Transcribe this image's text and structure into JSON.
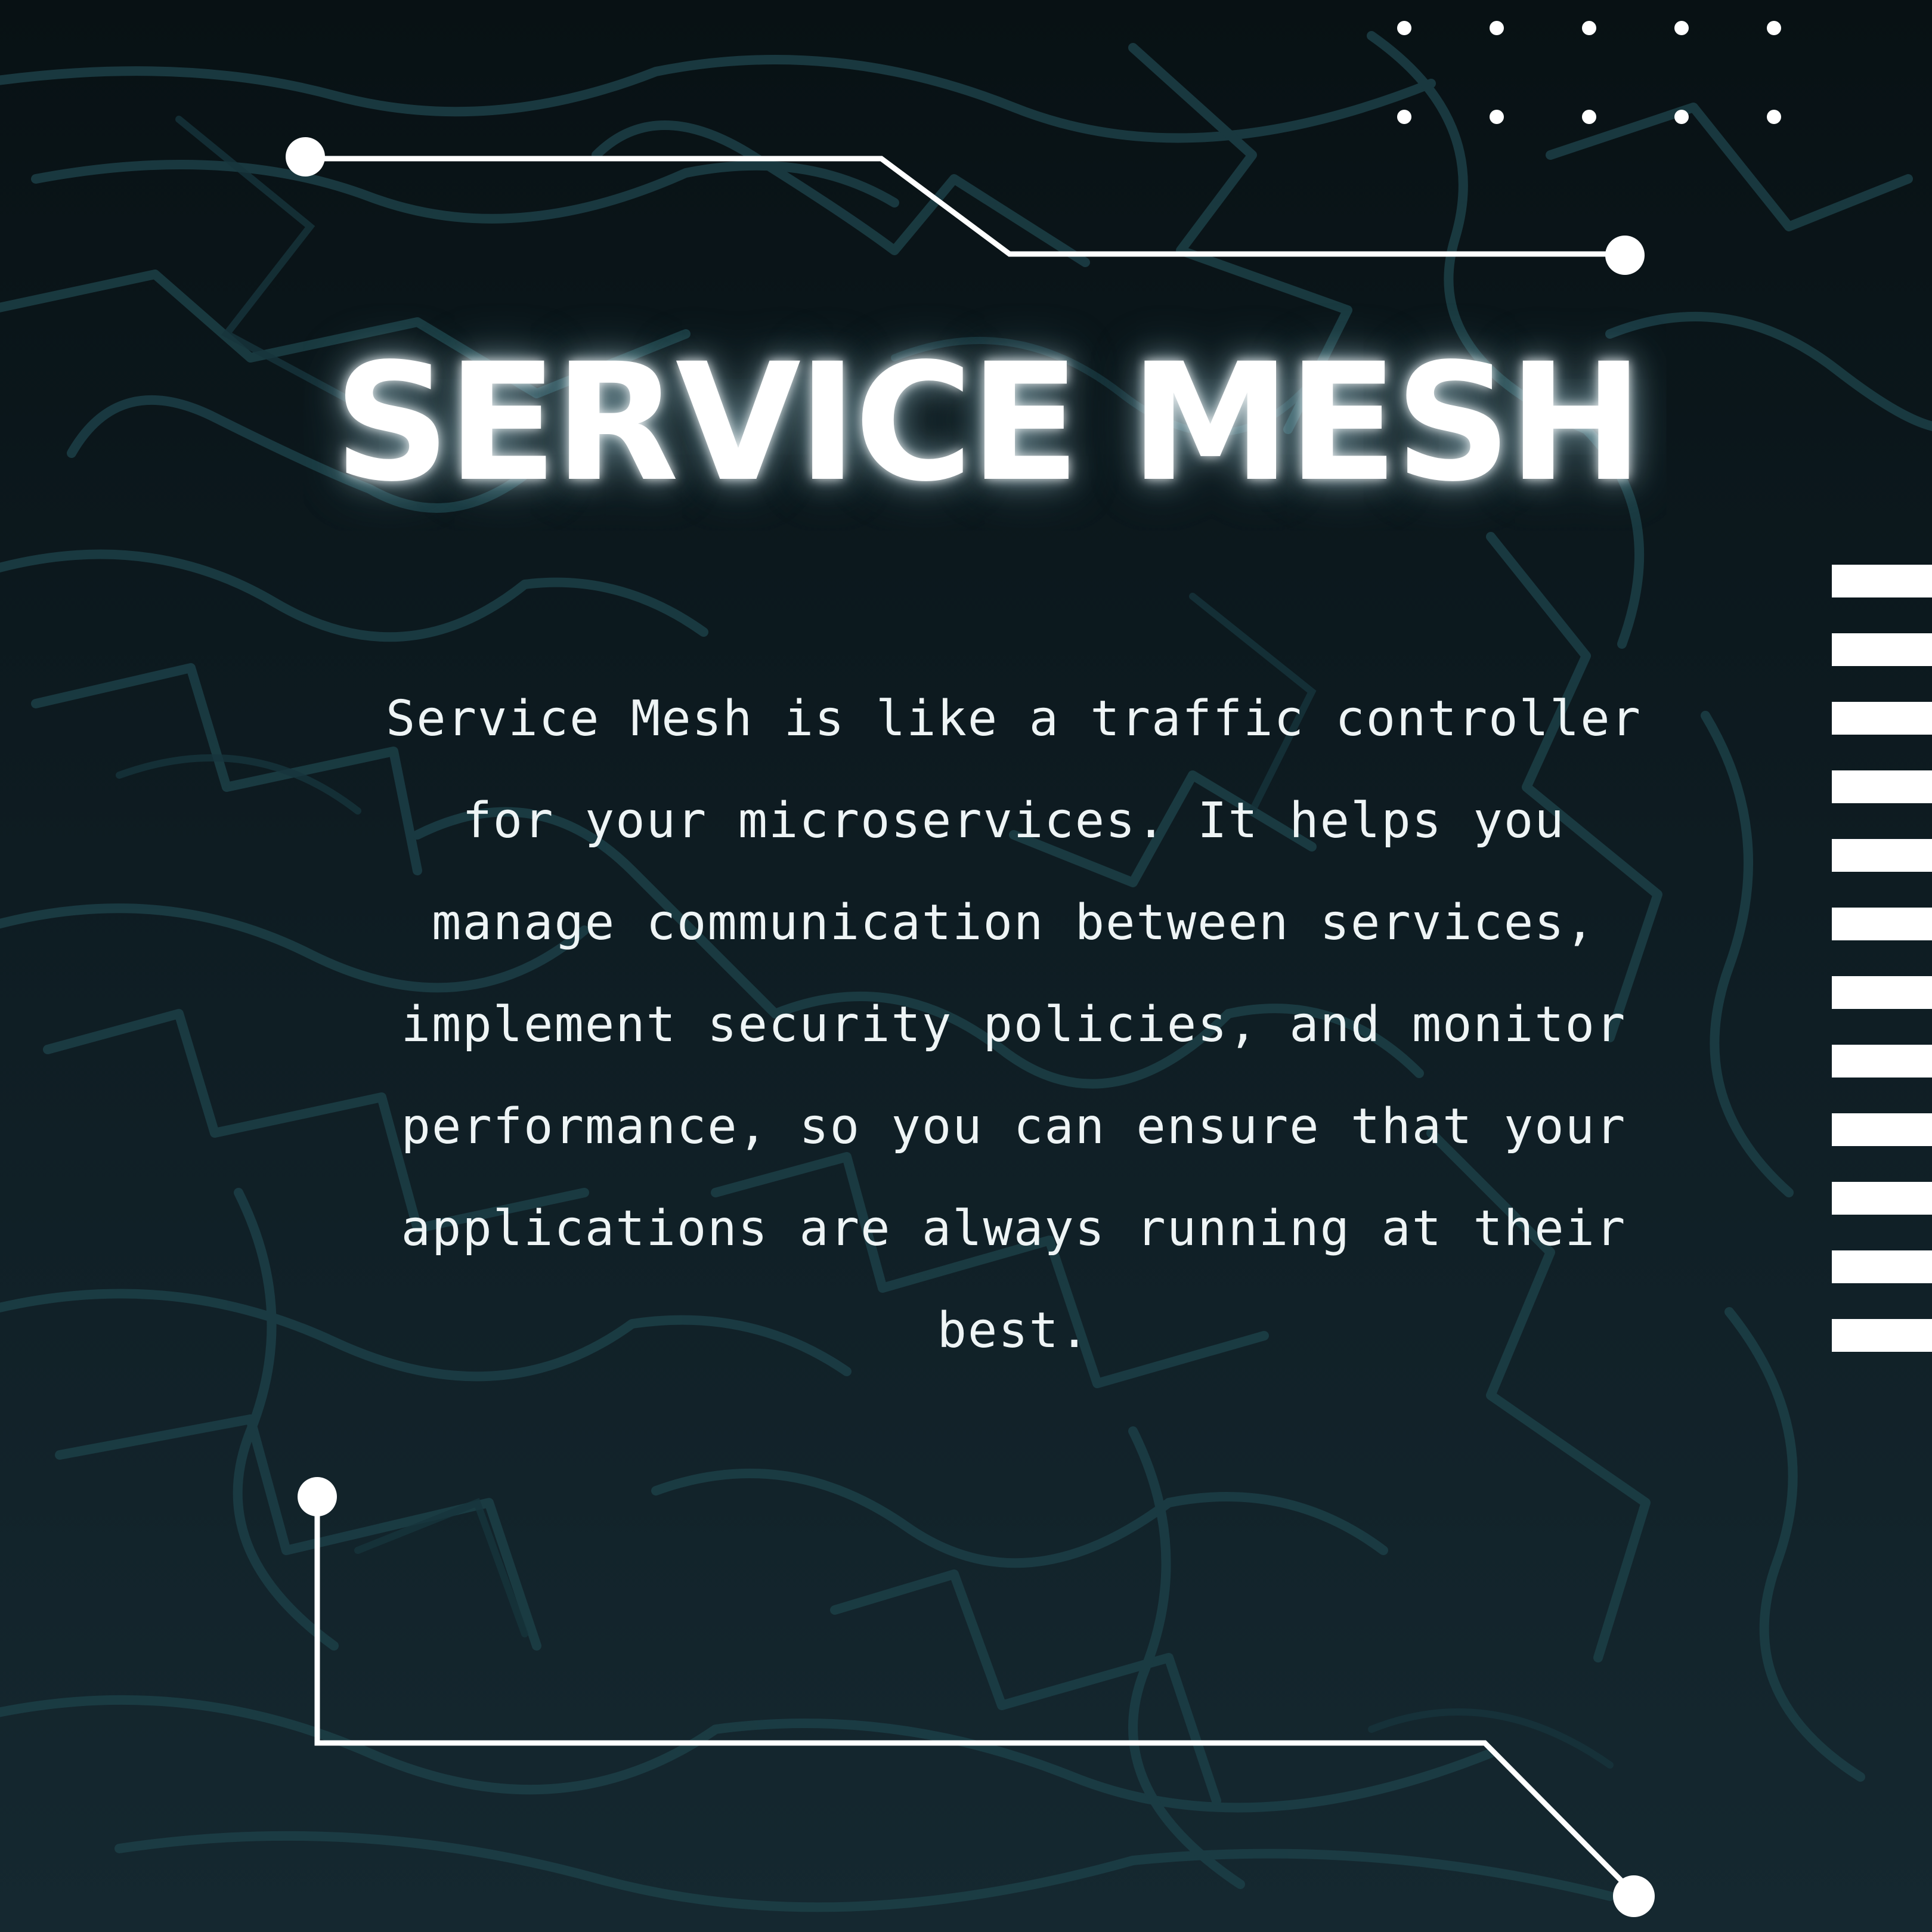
{
  "title": "SERVICE MESH",
  "description": "Service Mesh is like a traffic controller for your microservices. It helps you manage communication between services, implement security policies, and monitor performance, so you can ensure that your applications are always running at their best.",
  "colors": {
    "background_top": "#081114",
    "background_bottom": "#152830",
    "pattern": "#1c3f47",
    "text": "#ffffff"
  },
  "decor": {
    "dot_grid": "white dots, 2 rows x 5 columns, top-right",
    "circuit_line_top": "white circuit trace with round terminals, top-left",
    "circuit_line_bottom": "white circuit trace with round terminals, bottom",
    "side_stripes": "white horizontal stripes, right edge"
  }
}
